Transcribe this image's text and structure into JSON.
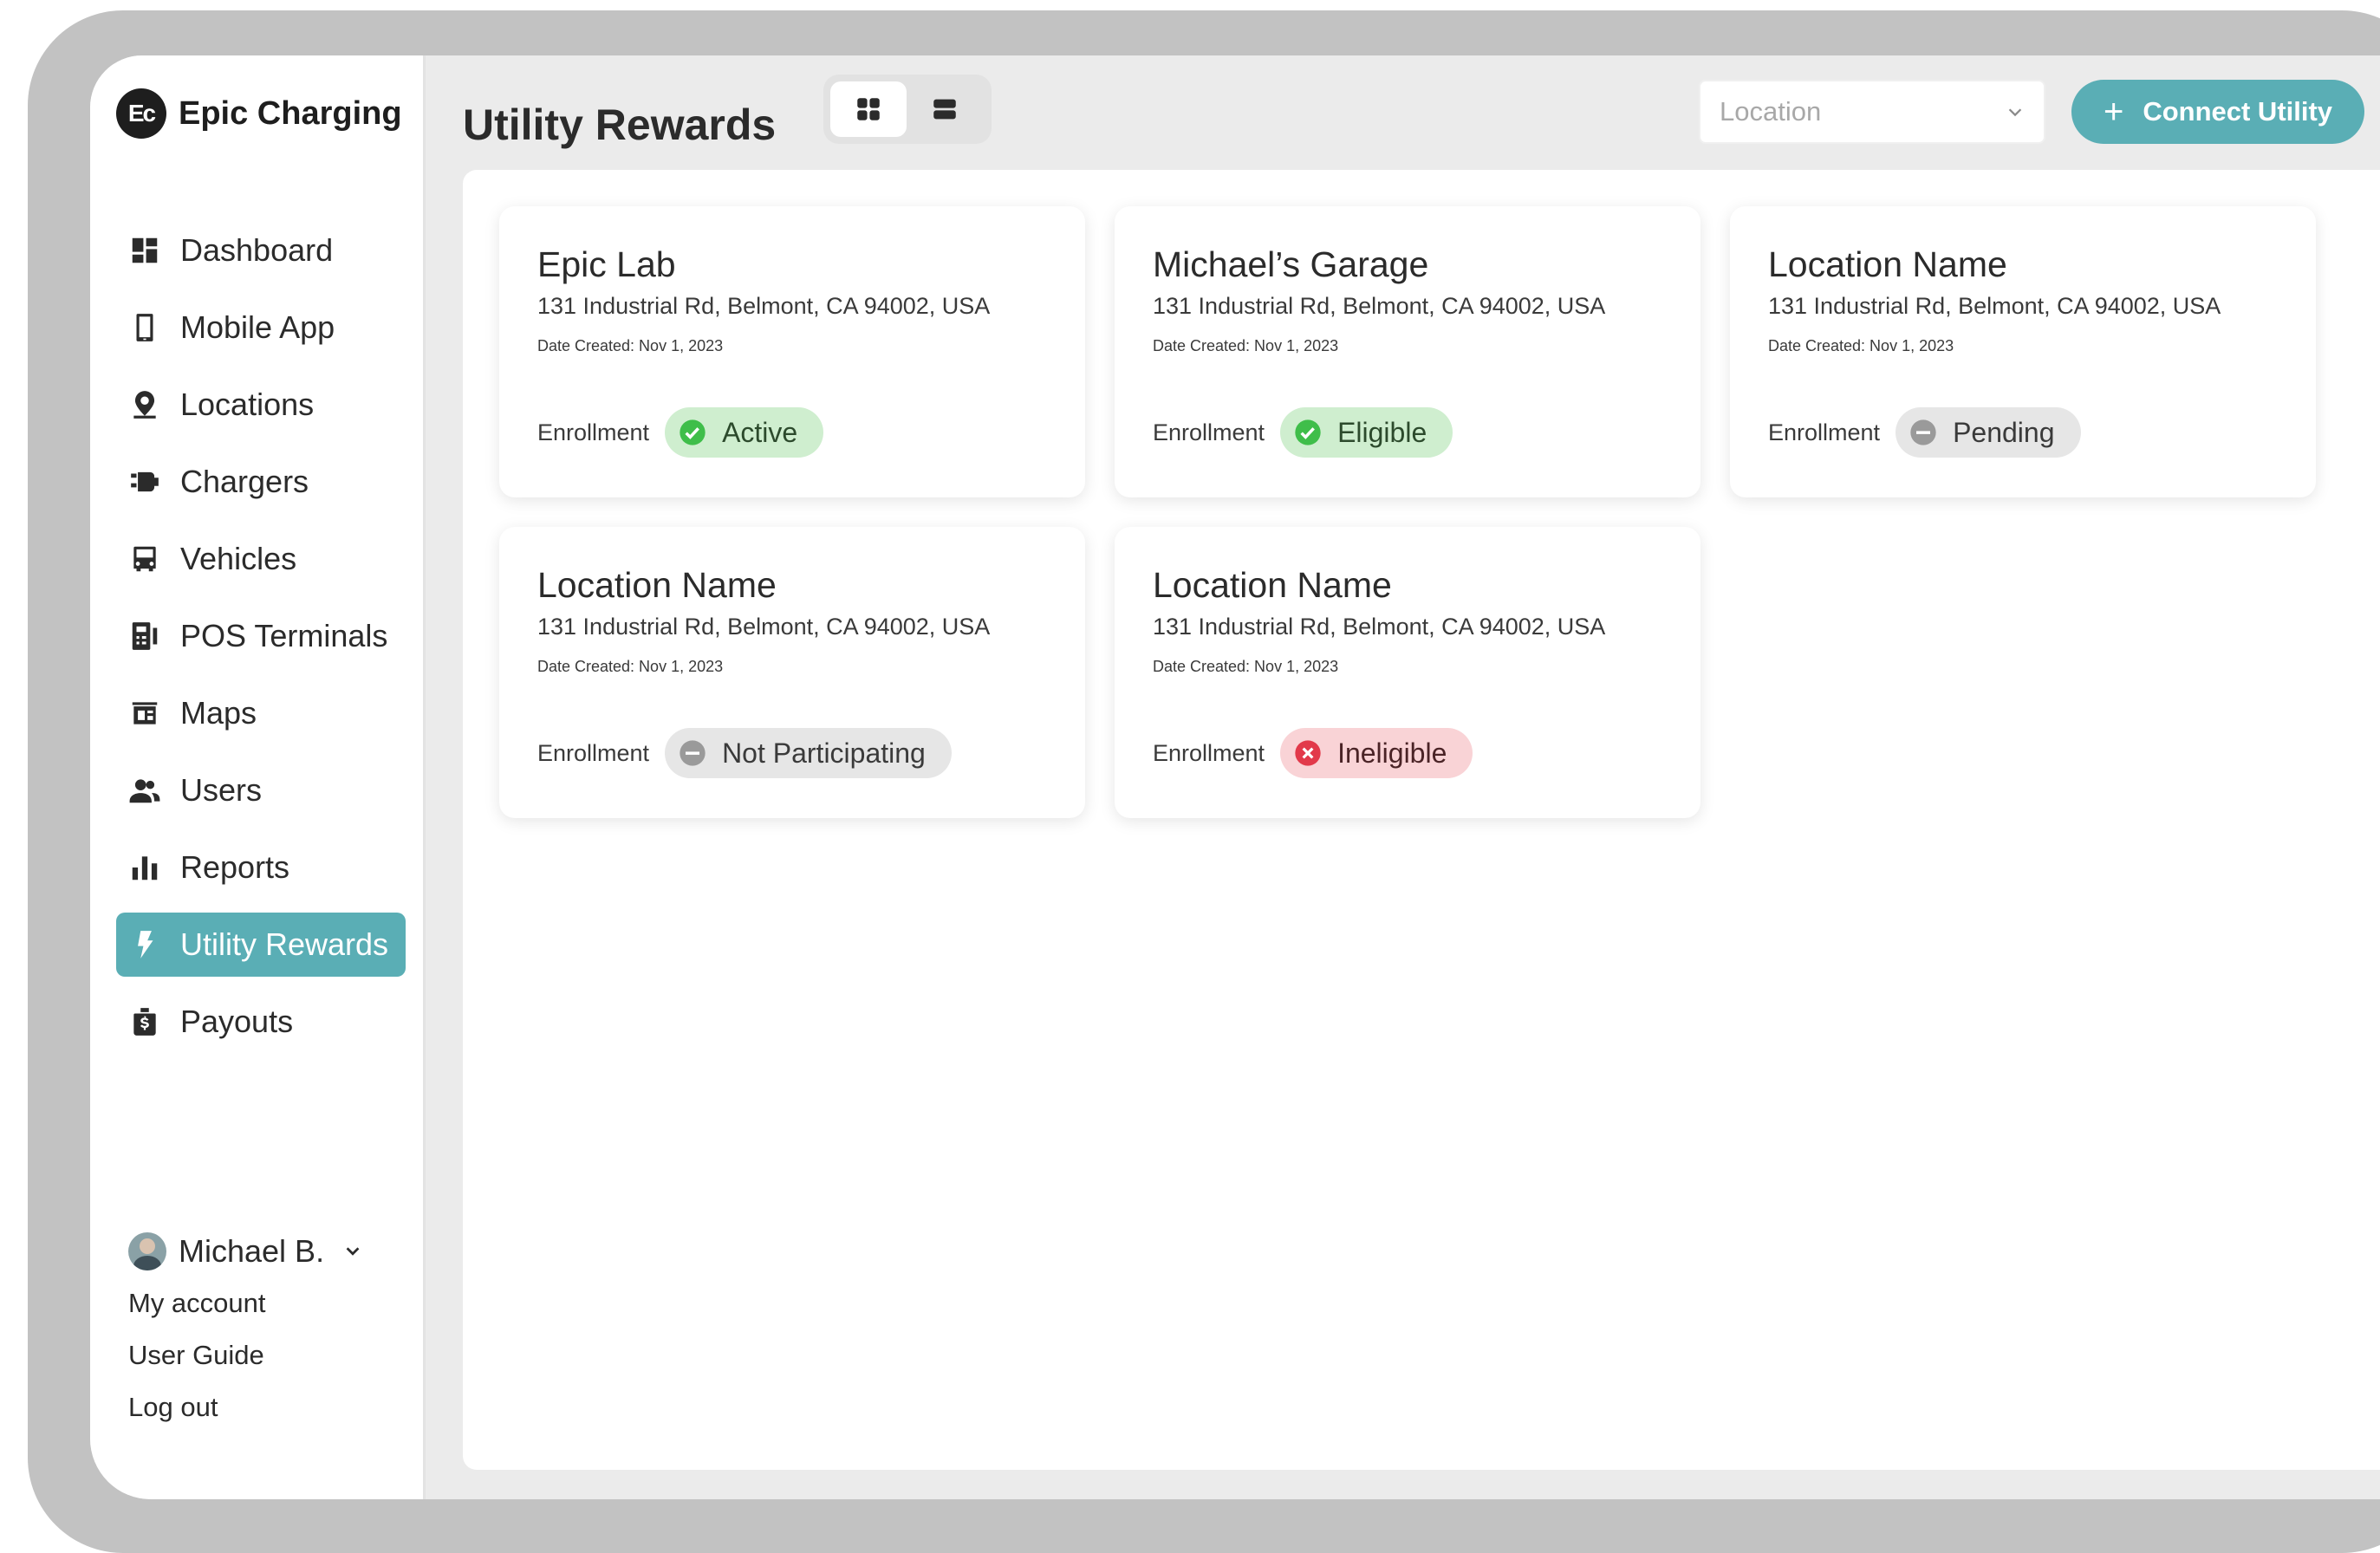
{
  "brand": {
    "logo_text": "Ec",
    "name": "Epic Charging"
  },
  "sidebar": {
    "items": [
      {
        "label": "Dashboard",
        "icon": "dashboard-icon",
        "active": false
      },
      {
        "label": "Mobile App",
        "icon": "mobile-icon",
        "active": false
      },
      {
        "label": "Locations",
        "icon": "location-pin-icon",
        "active": false
      },
      {
        "label": "Chargers",
        "icon": "charger-icon",
        "active": false
      },
      {
        "label": "Vehicles",
        "icon": "vehicle-icon",
        "active": false
      },
      {
        "label": "POS Terminals",
        "icon": "pos-terminal-icon",
        "active": false
      },
      {
        "label": "Maps",
        "icon": "map-icon",
        "active": false
      },
      {
        "label": "Users",
        "icon": "users-icon",
        "active": false
      },
      {
        "label": "Reports",
        "icon": "bar-chart-icon",
        "active": false
      },
      {
        "label": "Utility Rewards",
        "icon": "lightning-icon",
        "active": true
      },
      {
        "label": "Payouts",
        "icon": "money-bag-icon",
        "active": false
      }
    ]
  },
  "user": {
    "name": "Michael B.",
    "links": [
      "My account",
      "User Guide",
      "Log out"
    ]
  },
  "header": {
    "title": "Utility Rewards",
    "view_modes": [
      "grid-view-icon",
      "list-view-icon"
    ],
    "active_view": "grid",
    "location_placeholder": "Location",
    "connect_label": "Connect Utility"
  },
  "cards": [
    {
      "title": "Epic Lab",
      "address": "131 Industrial Rd, Belmont, CA 94002, USA",
      "date": "Date Created: Nov 1,  2023",
      "enrollment_label": "Enrollment",
      "status": "Active",
      "status_type": "green"
    },
    {
      "title": "Michael’s Garage",
      "address": "131 Industrial Rd, Belmont, CA 94002, USA",
      "date": "Date Created: Nov 1,  2023",
      "enrollment_label": "Enrollment",
      "status": "Eligible",
      "status_type": "green"
    },
    {
      "title": "Location Name",
      "address": "131 Industrial Rd, Belmont, CA 94002, USA",
      "date": "Date Created: Nov 1,  2023",
      "enrollment_label": "Enrollment",
      "status": "Pending",
      "status_type": "gray"
    },
    {
      "title": "Location Name",
      "address": "131 Industrial Rd, Belmont, CA 94002, USA",
      "date": "Date Created: Nov 1,  2023",
      "enrollment_label": "Enrollment",
      "status": "Not Participating",
      "status_type": "gray"
    },
    {
      "title": "Location Name",
      "address": "131 Industrial Rd, Belmont, CA 94002, USA",
      "date": "Date Created: Nov 1,  2023",
      "enrollment_label": "Enrollment",
      "status": "Ineligible",
      "status_type": "red"
    }
  ],
  "colors": {
    "accent": "#5aaeb5",
    "active_badge_bg": "#cfeecf",
    "check_green": "#3fbe4a",
    "neutral_badge_bg": "#e6e6e6",
    "ineligible_badge_bg": "#f9d3d6",
    "ineligible_red": "#e2394a"
  }
}
